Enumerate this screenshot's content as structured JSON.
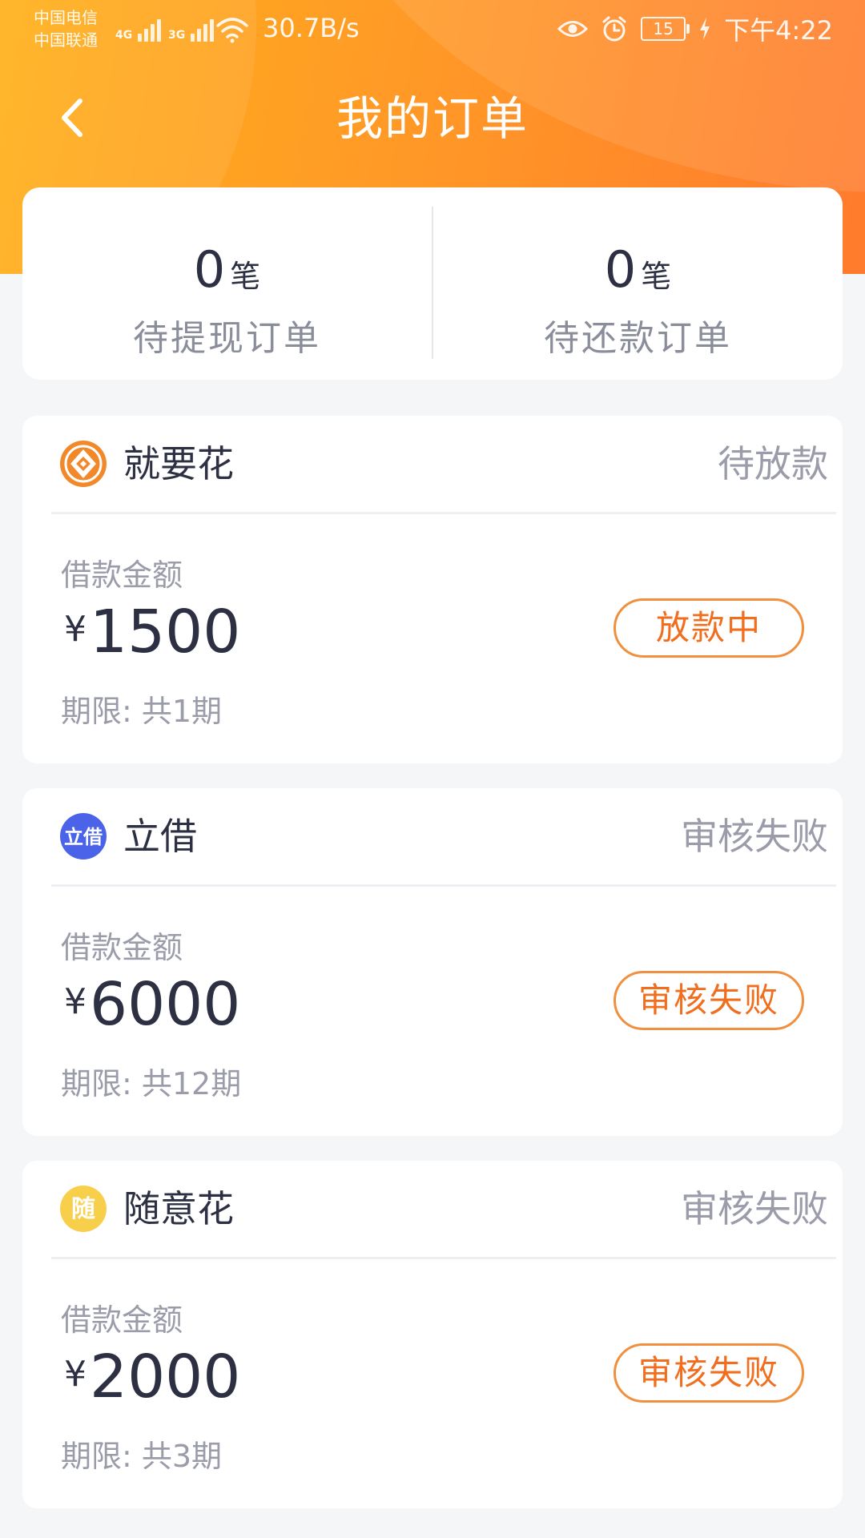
{
  "status_bar": {
    "carrier_1": "中国电信",
    "carrier_2": "中国联通",
    "signal_1_type": "4G",
    "signal_2_type": "3G",
    "net_speed": "30.7B/s",
    "battery": "15",
    "time": "下午4:22"
  },
  "header": {
    "title": "我的订单"
  },
  "summary": {
    "items": [
      {
        "count": "0",
        "unit": "笔",
        "label": "待提现订单"
      },
      {
        "count": "0",
        "unit": "笔",
        "label": "待还款订单"
      }
    ]
  },
  "orders": [
    {
      "product_name": "就要花",
      "status": "待放款",
      "amount_label": "借款金额",
      "currency": "¥",
      "amount": "1500",
      "term": "期限: 共1期",
      "action_label": "放款中",
      "logo_icon": "jiuyaohua-logo-icon"
    },
    {
      "product_name": "立借",
      "status": "审核失败",
      "amount_label": "借款金额",
      "currency": "¥",
      "amount": "6000",
      "term": "期限: 共12期",
      "action_label": "审核失败",
      "logo_icon": "lijie-logo-icon",
      "logo_text": "立借"
    },
    {
      "product_name": "随意花",
      "status": "审核失败",
      "amount_label": "借款金额",
      "currency": "¥",
      "amount": "2000",
      "term": "期限: 共3期",
      "action_label": "审核失败",
      "logo_icon": "suiyihua-logo-icon",
      "logo_text": "随"
    }
  ],
  "colors": {
    "header_start": "#ffb01a",
    "header_end": "#ff7b2d",
    "accent": "#f06e1e",
    "text_dark": "#2c3042",
    "text_muted": "#9a9caa"
  }
}
